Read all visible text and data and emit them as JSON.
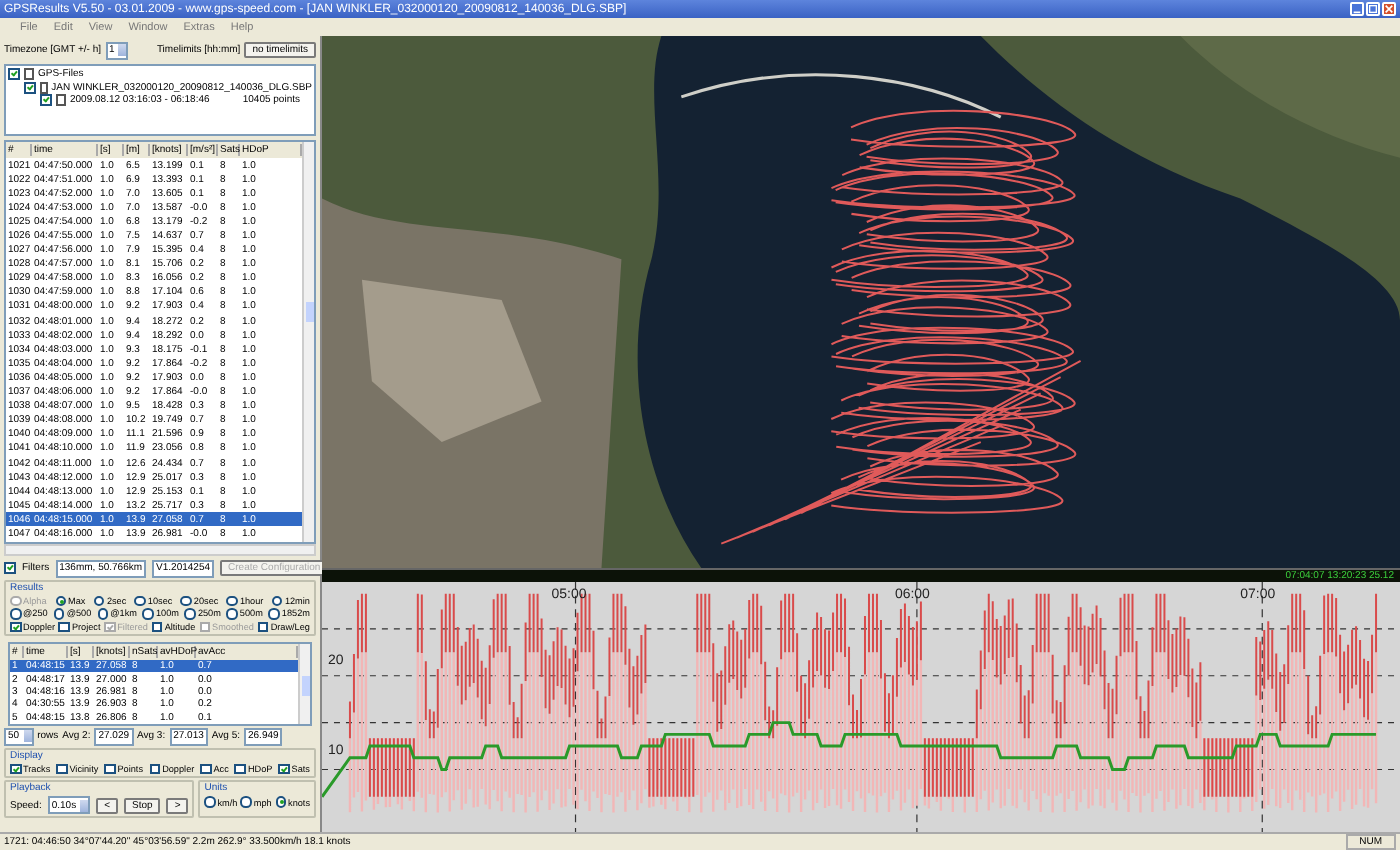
{
  "window": {
    "title": "GPSResults V5.50 - 03.01.2009 - www.gps-speed.com - [JAN WINKLER_032000120_20090812_140036_DLG.SBP]"
  },
  "menu": [
    "File",
    "Edit",
    "View",
    "Window",
    "Extras",
    "Help"
  ],
  "timezone": {
    "label": "Timezone [GMT +/- h]",
    "value": "1"
  },
  "timelimits": {
    "label": "Timelimits [hh:mm]",
    "button": "no timelimits"
  },
  "file_tree": [
    {
      "label": "GPS-Files",
      "checked": true,
      "children": [
        {
          "label": "JAN WINKLER_032000120_20090812_140036_DLG.SBP",
          "checked": true,
          "children": [
            {
              "label": "2009.08.12 03:16:03 - 06:18:46",
              "points": "10405 points",
              "checked": true
            }
          ]
        }
      ]
    }
  ],
  "points_table": {
    "columns": [
      "#",
      "time",
      "[s]",
      "[m]",
      "[knots]",
      "[m/s²]",
      "Sats",
      "HDoP"
    ],
    "rows": [
      {
        "cells": [
          "1021",
          "04:47:50.000",
          "1.0",
          "6.5",
          "13.199",
          "0.1",
          "8",
          "1.0"
        ],
        "selected": false
      },
      {
        "cells": [
          "1022",
          "04:47:51.000",
          "1.0",
          "6.9",
          "13.393",
          "0.1",
          "8",
          "1.0"
        ],
        "selected": false
      },
      {
        "cells": [
          "1023",
          "04:47:52.000",
          "1.0",
          "7.0",
          "13.605",
          "0.1",
          "8",
          "1.0"
        ],
        "selected": false
      },
      {
        "cells": [
          "1024",
          "04:47:53.000",
          "1.0",
          "7.0",
          "13.587",
          "-0.0",
          "8",
          "1.0"
        ],
        "selected": false
      },
      {
        "cells": [
          "1025",
          "04:47:54.000",
          "1.0",
          "6.8",
          "13.179",
          "-0.2",
          "8",
          "1.0"
        ],
        "selected": false
      },
      {
        "cells": [
          "1026",
          "04:47:55.000",
          "1.0",
          "7.5",
          "14.637",
          "0.7",
          "8",
          "1.0"
        ],
        "selected": false
      },
      {
        "cells": [
          "1027",
          "04:47:56.000",
          "1.0",
          "7.9",
          "15.395",
          "0.4",
          "8",
          "1.0"
        ],
        "selected": false
      },
      {
        "cells": [
          "1028",
          "04:47:57.000",
          "1.0",
          "8.1",
          "15.706",
          "0.2",
          "8",
          "1.0"
        ],
        "selected": false
      },
      {
        "cells": [
          "1029",
          "04:47:58.000",
          "1.0",
          "8.3",
          "16.056",
          "0.2",
          "8",
          "1.0"
        ],
        "selected": false
      },
      {
        "cells": [
          "1030",
          "04:47:59.000",
          "1.0",
          "8.8",
          "17.104",
          "0.6",
          "8",
          "1.0"
        ],
        "selected": false
      },
      {
        "cells": [
          "1031",
          "04:48:00.000",
          "1.0",
          "9.2",
          "17.903",
          "0.4",
          "8",
          "1.0"
        ],
        "selected": false
      },
      {
        "cells": [
          "1032",
          "04:48:01.000",
          "1.0",
          "9.4",
          "18.272",
          "0.2",
          "8",
          "1.0"
        ],
        "selected": false
      },
      {
        "cells": [
          "1033",
          "04:48:02.000",
          "1.0",
          "9.4",
          "18.292",
          "0.0",
          "8",
          "1.0"
        ],
        "selected": false
      },
      {
        "cells": [
          "1034",
          "04:48:03.000",
          "1.0",
          "9.3",
          "18.175",
          "-0.1",
          "8",
          "1.0"
        ],
        "selected": false
      },
      {
        "cells": [
          "1035",
          "04:48:04.000",
          "1.0",
          "9.2",
          "17.864",
          "-0.2",
          "8",
          "1.0"
        ],
        "selected": false
      },
      {
        "cells": [
          "1036",
          "04:48:05.000",
          "1.0",
          "9.2",
          "17.903",
          "0.0",
          "8",
          "1.0"
        ],
        "selected": false
      },
      {
        "cells": [
          "1037",
          "04:48:06.000",
          "1.0",
          "9.2",
          "17.864",
          "-0.0",
          "8",
          "1.0"
        ],
        "selected": false
      },
      {
        "cells": [
          "1038",
          "04:48:07.000",
          "1.0",
          "9.5",
          "18.428",
          "0.3",
          "8",
          "1.0"
        ],
        "selected": false
      },
      {
        "cells": [
          "1039",
          "04:48:08.000",
          "1.0",
          "10.2",
          "19.749",
          "0.7",
          "8",
          "1.0"
        ],
        "selected": false
      },
      {
        "cells": [
          "1040",
          "04:48:09.000",
          "1.0",
          "11.1",
          "21.596",
          "0.9",
          "8",
          "1.0"
        ],
        "selected": false
      },
      {
        "cells": [
          "1041",
          "04:48:10.000",
          "1.0",
          "11.9",
          "23.056",
          "0.8",
          "8",
          "1.0"
        ],
        "selected": false
      },
      {
        "cells": [
          "1042",
          "04:48:11.000",
          "1.0",
          "12.6",
          "24.434",
          "0.7",
          "8",
          "1.0"
        ],
        "selected": false
      },
      {
        "cells": [
          "1043",
          "04:48:12.000",
          "1.0",
          "12.9",
          "25.017",
          "0.3",
          "8",
          "1.0"
        ],
        "selected": false
      },
      {
        "cells": [
          "1044",
          "04:48:13.000",
          "1.0",
          "12.9",
          "25.153",
          "0.1",
          "8",
          "1.0"
        ],
        "selected": false
      },
      {
        "cells": [
          "1045",
          "04:48:14.000",
          "1.0",
          "13.2",
          "25.717",
          "0.3",
          "8",
          "1.0"
        ],
        "selected": false
      },
      {
        "cells": [
          "1046",
          "04:48:15.000",
          "1.0",
          "13.9",
          "27.058",
          "0.7",
          "8",
          "1.0"
        ],
        "selected": true
      },
      {
        "cells": [
          "1047",
          "04:48:16.000",
          "1.0",
          "13.9",
          "26.981",
          "-0.0",
          "8",
          "1.0"
        ],
        "selected": false
      }
    ]
  },
  "filters": {
    "label": "Filters",
    "checked": true,
    "fields": [
      "136mm, 50.766km",
      "V1.2014254"
    ],
    "button": "Create Configuration",
    "button_disabled": true
  },
  "results": {
    "label": "Results",
    "option_rows": [
      [
        {
          "label": "Alpha",
          "selected": false,
          "disabled": true
        },
        {
          "label": "Max",
          "selected": true,
          "disabled": false
        },
        {
          "label": "2sec",
          "selected": false,
          "disabled": false
        },
        {
          "label": "10sec",
          "selected": false,
          "disabled": false
        },
        {
          "label": "20sec",
          "selected": false,
          "disabled": false
        },
        {
          "label": "1hour",
          "selected": false,
          "disabled": false
        },
        {
          "label": "12min",
          "selected": false,
          "disabled": false
        }
      ],
      [
        {
          "label": "@250",
          "selected": false,
          "disabled": false
        },
        {
          "label": "@500",
          "selected": false,
          "disabled": false
        },
        {
          "label": "@1km",
          "selected": false,
          "disabled": false
        },
        {
          "label": "100m",
          "selected": false,
          "disabled": false
        },
        {
          "label": "250m",
          "selected": false,
          "disabled": false
        },
        {
          "label": "500m",
          "selected": false,
          "disabled": false
        },
        {
          "label": "1852m",
          "selected": false,
          "disabled": false
        }
      ]
    ],
    "checks": [
      {
        "label": "Doppler",
        "checked": true,
        "disabled": false
      },
      {
        "label": "Project",
        "checked": false,
        "disabled": false
      },
      {
        "label": "Filtered",
        "checked": true,
        "disabled": true
      },
      {
        "label": "Altitude",
        "checked": false,
        "disabled": false
      },
      {
        "label": "Smoothed",
        "checked": false,
        "disabled": true
      },
      {
        "label": "Draw/Leg",
        "checked": false,
        "disabled": false
      }
    ]
  },
  "results_table": {
    "columns": [
      "#",
      "time",
      "[s]",
      "[knots]",
      "nSats",
      "avHDoP",
      "avAcc"
    ],
    "rows": [
      {
        "cells": [
          "1",
          "04:48:15",
          "13.9",
          "27.058",
          "8",
          "1.0",
          "0.7"
        ],
        "selected": true
      },
      {
        "cells": [
          "2",
          "04:48:17",
          "13.9",
          "27.000",
          "8",
          "1.0",
          "0.0"
        ],
        "selected": false
      },
      {
        "cells": [
          "3",
          "04:48:16",
          "13.9",
          "26.981",
          "8",
          "1.0",
          "0.0"
        ],
        "selected": false
      },
      {
        "cells": [
          "4",
          "04:30:55",
          "13.9",
          "26.903",
          "8",
          "1.0",
          "0.2"
        ],
        "selected": false
      },
      {
        "cells": [
          "5",
          "04:48:15",
          "13.8",
          "26.806",
          "8",
          "1.0",
          "0.1"
        ],
        "selected": false
      }
    ]
  },
  "averages": {
    "rows": "50",
    "rows_label": "rows",
    "items": [
      {
        "label": "Avg 2:",
        "value": "27.029"
      },
      {
        "label": "Avg 3:",
        "value": "27.013"
      },
      {
        "label": "Avg 5:",
        "value": "26.949"
      }
    ]
  },
  "display": {
    "label": "Display",
    "checks": [
      {
        "label": "Tracks",
        "checked": true
      },
      {
        "label": "Vicinity",
        "checked": false
      },
      {
        "label": "Points",
        "checked": false
      },
      {
        "label": "Doppler",
        "checked": false
      },
      {
        "label": "Acc",
        "checked": false
      },
      {
        "label": "HDoP",
        "checked": false
      },
      {
        "label": "Sats",
        "checked": true
      }
    ]
  },
  "playback": {
    "label": "Playback",
    "speed_label": "Speed:",
    "speed": "0.10s",
    "buttons": [
      "<",
      "Stop",
      ">"
    ]
  },
  "units": {
    "label": "Units",
    "options": [
      {
        "label": "km/h",
        "selected": false
      },
      {
        "label": "mph",
        "selected": false
      },
      {
        "label": "knots",
        "selected": true
      }
    ]
  },
  "chart": {
    "readout": "07:04:07 13:20:23 25.12",
    "x_labels": [
      "05:00",
      "06:00",
      "07:00"
    ],
    "y_labels": [
      "20",
      "10"
    ]
  },
  "status_bar": {
    "text": "1721: 04:46:50 34°07'44.20\" 45°03'56.59\" 2.2m 262.9° 33.500km/h 18.1 knots",
    "indicator": "NUM"
  }
}
